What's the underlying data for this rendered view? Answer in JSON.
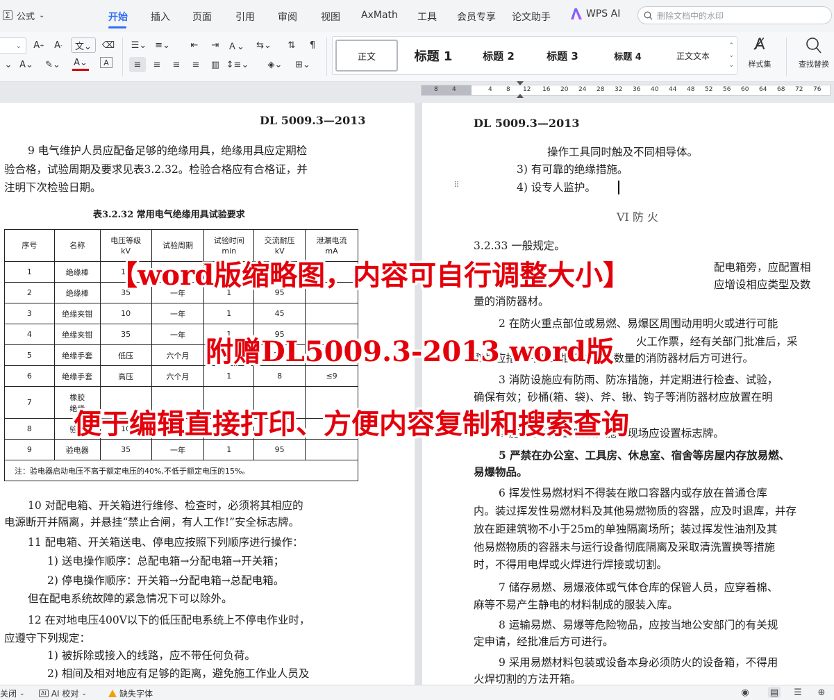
{
  "menubar": {
    "style_dropdown": "公式",
    "items": [
      "开始",
      "插入",
      "页面",
      "引用",
      "审阅",
      "视图",
      "AxMath",
      "工具",
      "会员专享",
      "论文助手"
    ],
    "wps_ai": "WPS AI",
    "search_placeholder": "删除文档中的水印"
  },
  "ribbon": {
    "styles": [
      "正文",
      "标题 1",
      "标题 2",
      "标题 3",
      "标题 4",
      "正文文本"
    ],
    "style_set_label": "样式集",
    "find_replace_label": "查找替换"
  },
  "ruler": {
    "numbers": [
      "8",
      "4",
      "4",
      "8",
      "12",
      "16",
      "20",
      "24",
      "28",
      "32",
      "36",
      "40",
      "44",
      "48",
      "52",
      "56",
      "60",
      "64",
      "68",
      "72",
      "76"
    ]
  },
  "left_page": {
    "header": "DL  5009.3—2013",
    "para9": [
      "9 电气维护人员应配备足够的绝缘用具，绝缘用具应定期检",
      "验合格，试验周期及要求见表3.2.32。检验合格应有合格证，并",
      "注明下次检验日期。"
    ],
    "table_title": "表3.2.32 常用电气绝缘用具试验要求",
    "table_headers": [
      "序号",
      "名称",
      "电压等级\nkV",
      "试验周期",
      "试验时间\nmin",
      "交流耐压\nkV",
      "泄漏电流\nmA"
    ],
    "table_rows": [
      [
        "1",
        "绝缘棒",
        "10",
        "",
        "",
        "",
        ""
      ],
      [
        "2",
        "绝缘棒",
        "35",
        "一年",
        "1",
        "95",
        ""
      ],
      [
        "3",
        "绝缘夹钳",
        "10",
        "一年",
        "1",
        "45",
        ""
      ],
      [
        "4",
        "绝缘夹钳",
        "35",
        "一年",
        "1",
        "95",
        ""
      ],
      [
        "5",
        "绝缘手套",
        "低压",
        "六个月",
        "1",
        "2.5",
        ""
      ],
      [
        "6",
        "绝缘手套",
        "高压",
        "六个月",
        "1",
        "8",
        "≤9"
      ],
      [
        "7",
        "橡胶\n绝缘",
        "",
        "",
        "",
        "",
        ""
      ],
      [
        "8",
        "验电",
        "10",
        "",
        "",
        "",
        ""
      ],
      [
        "9",
        "验电器",
        "35",
        "一年",
        "1",
        "95",
        ""
      ]
    ],
    "table_note": "注：验电器启动电压不高于额定电压的40%,不低于额定电压的15%。",
    "para10": [
      "10 对配电箱、开关箱进行维修、检查时，必须将其相应的",
      "电源断开并隔离，并悬挂“禁止合闸，有人工作!”安全标志牌。"
    ],
    "para11": "11  配电箱、开关箱送电、停电应按照下列顺序进行操作：",
    "para11_1": "1)   送电操作顺序：总配电箱→分配电箱→开关箱；",
    "para11_2": "2)  停电操作顺序：开关箱→分配电箱→总配电箱。",
    "para11_end": "但在配电系统故障的紧急情况下可以除外。",
    "para12": [
      "12 在对地电压400V以下的低压配电系统上不停电作业时，",
      "应遵守下列规定："
    ],
    "para12_1": "1) 被拆除或接入的线路，应不带任何负荷。",
    "para12_2": "2)  相间及相对地应有足够的距离，避免施工作业人员及"
  },
  "right_page": {
    "header": "DL  5009.3—2013",
    "lines_top": [
      "操作工具同时触及不同相导体。",
      "3)    有可靠的绝缘措施。",
      "4)   设专人监护。"
    ],
    "section_title": "VI   防    火",
    "p3233": "3.2.33  一般规定。",
    "p1": [
      "配电箱旁，应配置相",
      "量的消防器材。"
    ],
    "p1_partial": "应增设相应类型及数",
    "p2": [
      "2  在防火重点部位或易燃、易爆区周围动用明火或进行可能",
      "火工作票，经有关部门批准后，采"
    ],
    "p2_partial": "取相应措施并增设相应类型及数量的消防器材后方可进行。",
    "p3": [
      "3  消防设施应有防雨、防冻措施，并定期进行检查、试验，",
      "确保有效；砂桶(箱、袋)、斧、锹、钩子等消防器材应放置在明"
    ],
    "p4_partial": "4  施工现场禁止吸烟，施工现场应设置标志牌。",
    "p5": [
      "5 严禁在办公室、工具房、休息室、宿舍等房屋内存放易燃、",
      "易爆物品。"
    ],
    "p6": [
      "6  挥发性易燃材料不得装在敞口容器内或存放在普通仓库",
      "内。装过挥发性易燃材料及其他易燃物质的容器，应及时退库，并存",
      "放在距建筑物不小于25m的单独隔离场所；装过挥发性油剂及其",
      "他易燃物质的容器未与运行设备彻底隔离及采取清洗置换等措施",
      "时，不得用电焊或火焊进行焊接或切割。"
    ],
    "p7": [
      "7  储存易燃、易爆液体或气体仓库的保管人员，应穿着棉、",
      "麻等不易产生静电的材料制成的服装入库。"
    ],
    "p8": [
      "8  运输易燃、易爆等危险物品，应按当地公安部门的有关规",
      "定申请，经批准后方可进行。"
    ],
    "p9": [
      "9  采用易燃材料包装或设备本身必须防火的设备箱，不得用",
      "火焊切割的方法开箱。"
    ]
  },
  "overlays": {
    "line1": "【word版缩略图，内容可自行调整大小】",
    "line2": "附赠DL5009.3-2013 word版",
    "line3": "便于编辑直接打印、方便内容复制和搜索查询"
  },
  "statusbar": {
    "close_label": "关闭",
    "ai_check": "AI 校对",
    "missing_font": "缺失字体"
  }
}
